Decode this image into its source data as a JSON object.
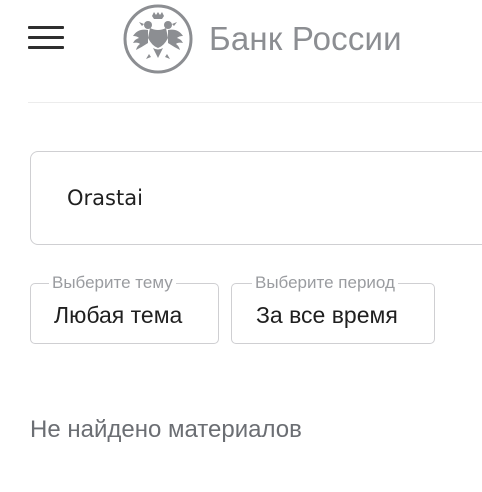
{
  "header": {
    "menu_icon": "hamburger-menu-icon",
    "logo_icon": "double-headed-eagle-emblem",
    "logo_text": "Банк России",
    "logo_color": "#8c8e92"
  },
  "search": {
    "value": "Orastai",
    "icon": "none"
  },
  "filters": {
    "topic": {
      "legend": "Выберите тему",
      "value": "Любая тема"
    },
    "period": {
      "legend": "Выберите период",
      "value": "За все время"
    }
  },
  "results": {
    "empty_message": "Не найдено материалов"
  },
  "colors": {
    "border": "#cfcfd2",
    "legend_text": "#9a9ca0",
    "muted_text": "#6b6e73",
    "body_text": "#1f1f1f"
  }
}
